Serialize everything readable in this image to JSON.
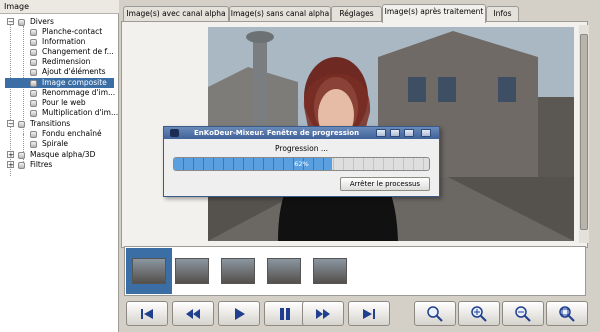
{
  "tree": {
    "header": "Image",
    "items": [
      {
        "label": "Divers",
        "level": 0,
        "expander": "-"
      },
      {
        "label": "Planche-contact",
        "level": 1
      },
      {
        "label": "Information",
        "level": 1
      },
      {
        "label": "Changement de f...",
        "level": 1
      },
      {
        "label": "Redimension",
        "level": 1
      },
      {
        "label": "Ajout d'éléments",
        "level": 1
      },
      {
        "label": "Image composite",
        "level": 1,
        "selected": true
      },
      {
        "label": "Renommage d'im...",
        "level": 1
      },
      {
        "label": "Pour le web",
        "level": 1
      },
      {
        "label": "Multiplication d'im...",
        "level": 1
      },
      {
        "label": "Transitions",
        "level": 0,
        "expander": "-"
      },
      {
        "label": "Fondu enchaîné",
        "level": 1
      },
      {
        "label": "Spirale",
        "level": 1
      },
      {
        "label": "Masque alpha/3D",
        "level": 0,
        "expander": "+"
      },
      {
        "label": "Filtres",
        "level": 0,
        "expander": "+"
      }
    ]
  },
  "tabs": [
    {
      "label": "Image(s) avec canal alpha"
    },
    {
      "label": "Image(s) sans canal alpha"
    },
    {
      "label": "Réglages"
    },
    {
      "label": "Image(s) après traitement",
      "active": true
    },
    {
      "label": "Infos"
    }
  ],
  "dialog": {
    "title": "EnKoDeur-Mixeur. Fenêtre de progression",
    "label": "Progression ...",
    "progress_value": 62,
    "progress_text": "62%",
    "stop_label": "Arrêter le processus"
  },
  "controls": {
    "buttons": [
      {
        "icon": "skip-first-icon"
      },
      {
        "icon": "rewind-icon"
      },
      {
        "icon": "play-icon"
      },
      {
        "icon": "pause-icon"
      },
      {
        "icon": "fast-forward-icon"
      },
      {
        "icon": "skip-last-icon"
      }
    ],
    "zoom": [
      {
        "icon": "zoom-icon"
      },
      {
        "icon": "zoom-in-icon"
      },
      {
        "icon": "zoom-out-icon"
      },
      {
        "icon": "zoom-fit-icon"
      }
    ]
  },
  "colors": {
    "selection": "#3a6ea5",
    "accent": "#1f3f8f",
    "progress": "#4a90d9"
  }
}
